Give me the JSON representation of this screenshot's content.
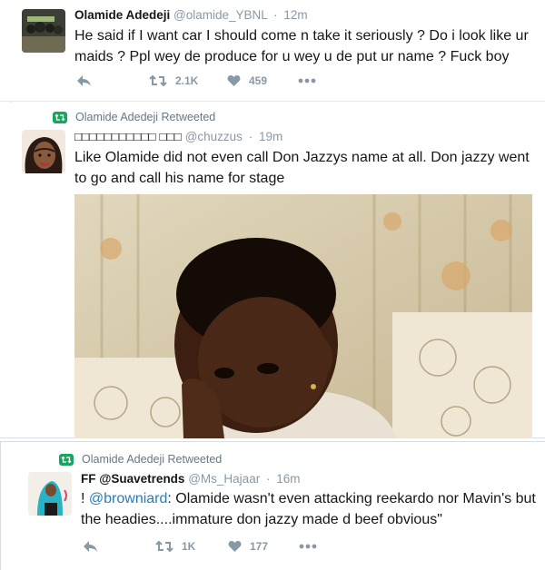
{
  "tweets": [
    {
      "name": "Olamide Adedeji",
      "handle": "@olamide_YBNL",
      "time": "12m",
      "text": "He said if I want car I should come n take it seriously ? Do i look like ur maids ? Ppl wey de produce for u wey u de put ur name ? Fuck boy",
      "retweets": "2.1K",
      "likes": "459"
    },
    {
      "retweeted_by": "Olamide Adedeji Retweeted",
      "name": "□□□□□□□□□□□ □□□",
      "handle": "@chuzzus",
      "time": "19m",
      "text": "Like Olamide did not even call Don Jazzys name at all. Don jazzy went to go and call his name for stage"
    },
    {
      "retweeted_by": "Olamide Adedeji Retweeted",
      "name": "FF @Suavetrends",
      "handle": "@Ms_Hajaar",
      "time": "16m",
      "text_prefix": "! ",
      "mention": "@browniard",
      "text_rest": ": Olamide wasn't even attacking reekardo nor Mavin's but the headies....immature don jazzy made d beef obvious\"",
      "retweets": "1K",
      "likes": "177"
    }
  ],
  "icons": {
    "reply": "reply-icon",
    "retweet": "retweet-icon",
    "like": "heart-icon",
    "more": "more-icon"
  },
  "colors": {
    "retweet_badge": "#19a560",
    "mention": "#2b7bb9",
    "muted": "#8899a6"
  }
}
